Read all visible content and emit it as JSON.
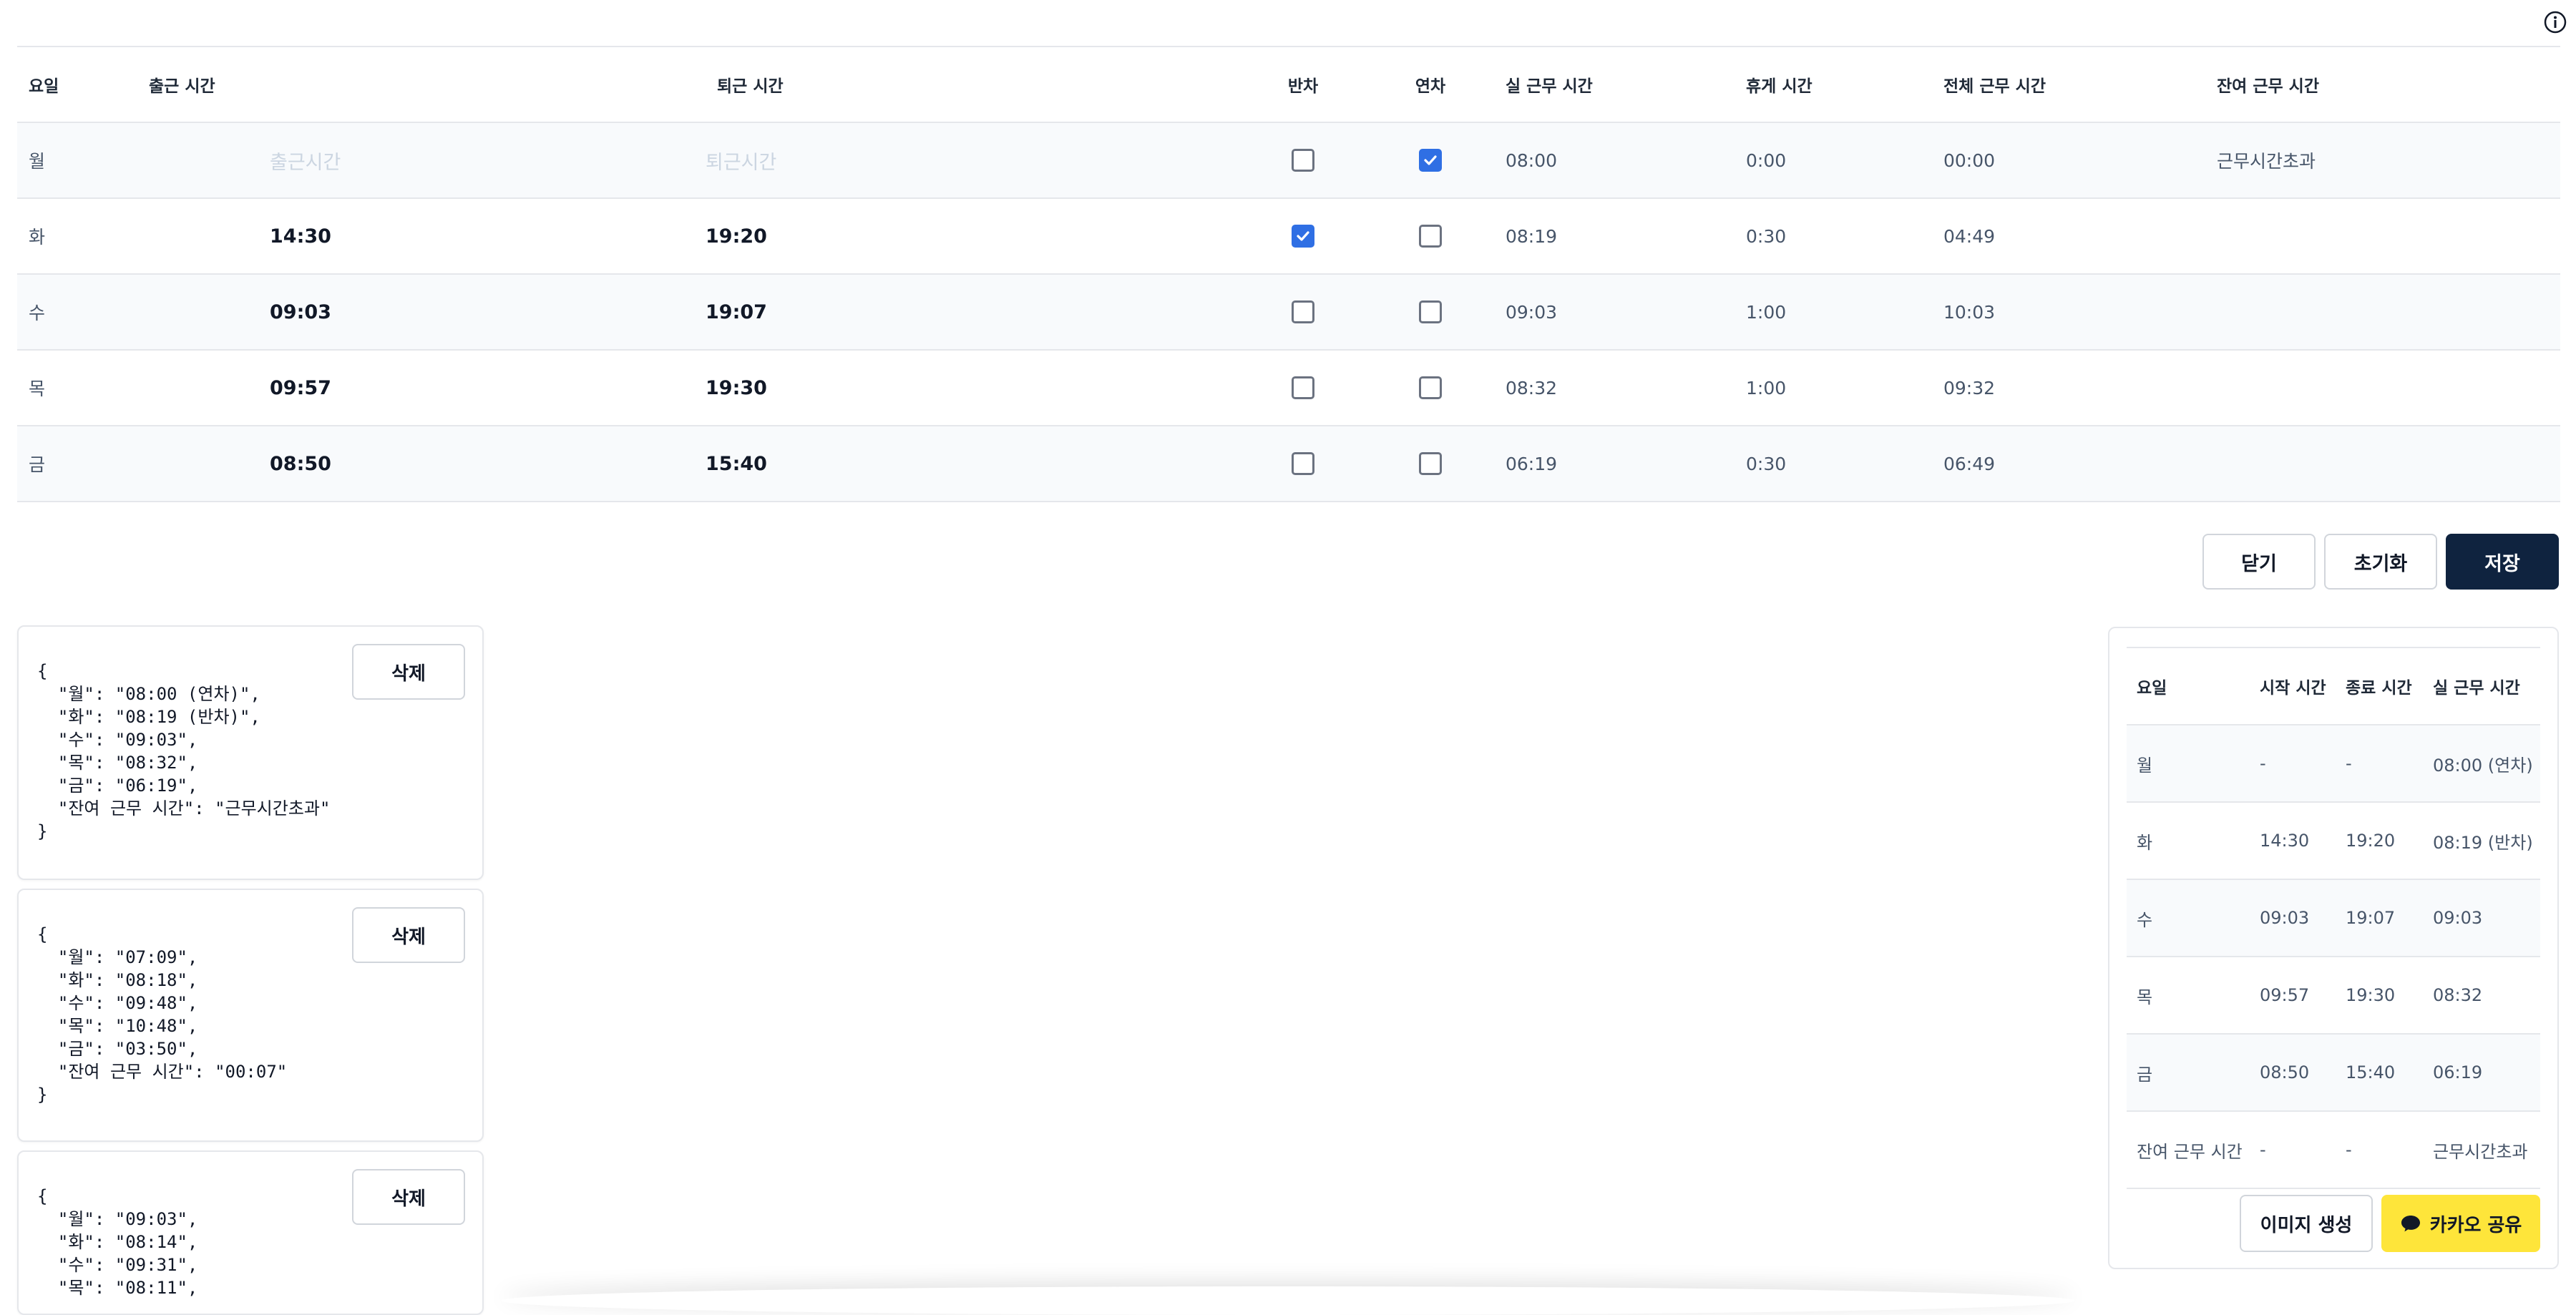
{
  "main_table": {
    "headers": {
      "day": "요일",
      "clock_in": "출근 시간",
      "clock_out": "퇴근 시간",
      "half_day": "반차",
      "annual_leave": "연차",
      "actual_work": "실 근무 시간",
      "break": "휴게 시간",
      "total_work": "전체 근무 시간",
      "remaining": "잔여 근무 시간"
    },
    "rows": [
      {
        "day": "월",
        "clock_in": "",
        "clock_in_placeholder": "출근시간",
        "clock_out": "",
        "clock_out_placeholder": "퇴근시간",
        "half_day": false,
        "annual_leave": true,
        "actual": "08:00",
        "break": "0:00",
        "total": "00:00",
        "remaining": "근무시간초과"
      },
      {
        "day": "화",
        "clock_in": "14:30",
        "clock_out": "19:20",
        "half_day": true,
        "annual_leave": false,
        "actual": "08:19",
        "break": "0:30",
        "total": "04:49",
        "remaining": ""
      },
      {
        "day": "수",
        "clock_in": "09:03",
        "clock_out": "19:07",
        "half_day": false,
        "annual_leave": false,
        "actual": "09:03",
        "break": "1:00",
        "total": "10:03",
        "remaining": ""
      },
      {
        "day": "목",
        "clock_in": "09:57",
        "clock_out": "19:30",
        "half_day": false,
        "annual_leave": false,
        "actual": "08:32",
        "break": "1:00",
        "total": "09:32",
        "remaining": ""
      },
      {
        "day": "금",
        "clock_in": "08:50",
        "clock_out": "15:40",
        "half_day": false,
        "annual_leave": false,
        "actual": "06:19",
        "break": "0:30",
        "total": "06:49",
        "remaining": ""
      }
    ]
  },
  "actions": {
    "close": "닫기",
    "reset": "초기화",
    "save": "저장"
  },
  "saved_records": {
    "delete_label": "삭제",
    "items": [
      "{\n  \"월\": \"08:00 (연차)\",\n  \"화\": \"08:19 (반차)\",\n  \"수\": \"09:03\",\n  \"목\": \"08:32\",\n  \"금\": \"06:19\",\n  \"잔여 근무 시간\": \"근무시간초과\"\n}",
      "{\n  \"월\": \"07:09\",\n  \"화\": \"08:18\",\n  \"수\": \"09:48\",\n  \"목\": \"10:48\",\n  \"금\": \"03:50\",\n  \"잔여 근무 시간\": \"00:07\"\n}",
      "{\n  \"월\": \"09:03\",\n  \"화\": \"08:14\",\n  \"수\": \"09:31\",\n  \"목\": \"08:11\","
    ]
  },
  "summary": {
    "headers": {
      "day": "요일",
      "start": "시작 시간",
      "end": "종료 시간",
      "actual": "실 근무 시간"
    },
    "rows": [
      {
        "day": "월",
        "start": "-",
        "end": "-",
        "actual": "08:00 (연차)"
      },
      {
        "day": "화",
        "start": "14:30",
        "end": "19:20",
        "actual": "08:19 (반차)"
      },
      {
        "day": "수",
        "start": "09:03",
        "end": "19:07",
        "actual": "09:03"
      },
      {
        "day": "목",
        "start": "09:57",
        "end": "19:30",
        "actual": "08:32"
      },
      {
        "day": "금",
        "start": "08:50",
        "end": "15:40",
        "actual": "06:19"
      },
      {
        "day": "잔여 근무 시간",
        "start": "-",
        "end": "-",
        "actual": "근무시간초과"
      }
    ],
    "make_image": "이미지 생성",
    "kakao_share": "카카오 공유"
  },
  "colors": {
    "primary_dark": "#0f233f",
    "checkbox_blue": "#2f6fe4",
    "kakao_yellow": "#fee53a"
  },
  "icons": {
    "info": "info-icon",
    "chat": "chat-bubble-icon",
    "check": "check-icon"
  }
}
